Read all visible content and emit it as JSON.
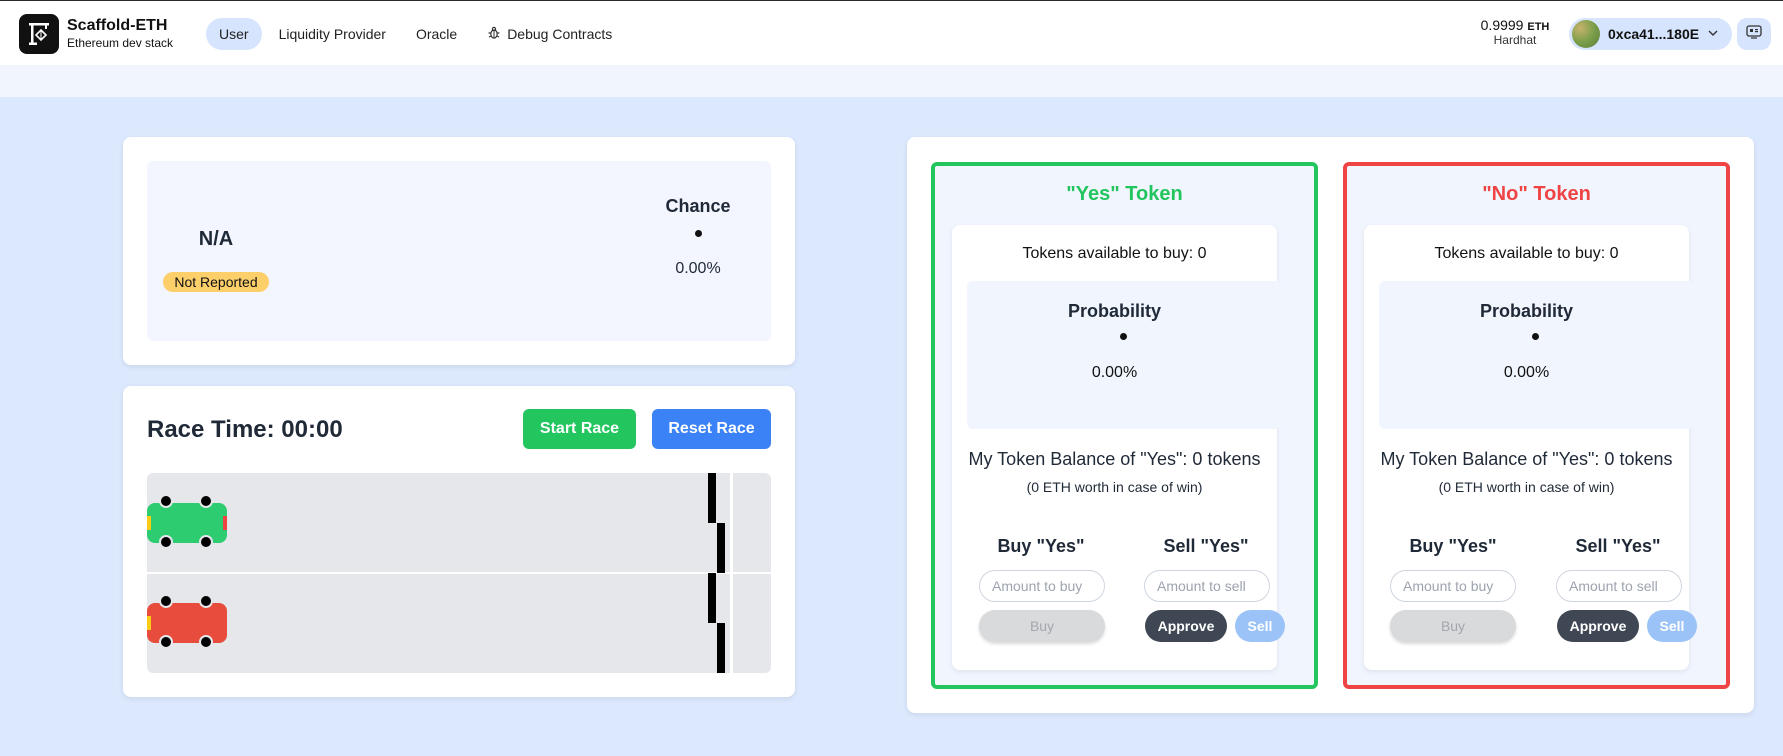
{
  "header": {
    "brand_title": "Scaffold-ETH",
    "brand_subtitle": "Ethereum dev stack",
    "nav": [
      {
        "label": "User",
        "active": true
      },
      {
        "label": "Liquidity Provider",
        "active": false
      },
      {
        "label": "Oracle",
        "active": false
      },
      {
        "label": "Debug Contracts",
        "active": false,
        "icon": "bug-icon"
      }
    ],
    "balance": "0.9999",
    "balance_unit": "ETH",
    "network": "Hardhat",
    "account": "0xca41...180E"
  },
  "status": {
    "outcome": "N/A",
    "badge": "Not Reported",
    "chance_label": "Chance",
    "chance_value": "0.00%"
  },
  "race": {
    "title": "Race Time: 00:00",
    "start_label": "Start Race",
    "reset_label": "Reset Race",
    "cars": [
      {
        "color": "#2ecc71"
      },
      {
        "color": "#e74c3c"
      }
    ]
  },
  "tokens": [
    {
      "title": "\"Yes\" Token",
      "title_color": "#22c55e",
      "border_color": "#22c55e",
      "available": "Tokens available to buy: 0",
      "prob_label": "Probability",
      "prob_value": "0.00%",
      "my_balance": "My Token Balance of \"Yes\": 0 tokens",
      "worth": "(0 ETH worth in case of win)",
      "buy_heading": "Buy \"Yes\"",
      "sell_heading": "Sell \"Yes\"",
      "buy_placeholder": "Amount to buy",
      "sell_placeholder": "Amount to sell",
      "buy_label": "Buy",
      "approve_label": "Approve",
      "sell_label": "Sell"
    },
    {
      "title": "\"No\" Token",
      "title_color": "#ef4444",
      "border_color": "#ef4444",
      "available": "Tokens available to buy: 0",
      "prob_label": "Probability",
      "prob_value": "0.00%",
      "my_balance": "My Token Balance of \"Yes\": 0 tokens",
      "worth": "(0 ETH worth in case of win)",
      "buy_heading": "Buy \"Yes\"",
      "sell_heading": "Sell \"Yes\"",
      "buy_placeholder": "Amount to buy",
      "sell_placeholder": "Amount to sell",
      "buy_label": "Buy",
      "approve_label": "Approve",
      "sell_label": "Sell"
    }
  ]
}
